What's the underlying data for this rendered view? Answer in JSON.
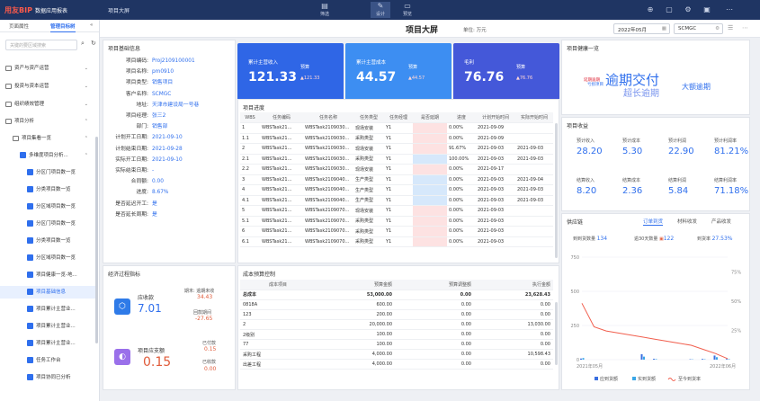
{
  "topbar": {
    "logo": "用友BIP",
    "app_name": "数据应用报表",
    "title": "项目大屏",
    "buttons": [
      "筛选",
      "设计",
      "预览"
    ]
  },
  "sidebar": {
    "tabs": [
      "页面属性",
      "管理目标树"
    ],
    "search_placeholder": "关键的要区域搜索",
    "items": [
      {
        "label": "资产与资产运营",
        "type": "folder"
      },
      {
        "label": "投资与资本运营",
        "type": "folder"
      },
      {
        "label": "组织绩效管理",
        "type": "folder"
      },
      {
        "label": "项目分析",
        "type": "folder"
      },
      {
        "label": "项目集看一览",
        "type": "folder"
      },
      {
        "label": "多维度项目分析...",
        "type": "report"
      },
      {
        "label": "分区门项目数一览",
        "type": "report"
      },
      {
        "label": "分类项目数一览",
        "type": "report"
      },
      {
        "label": "分区域项目数一览",
        "type": "report"
      },
      {
        "label": "分区门项目数一览",
        "type": "report"
      },
      {
        "label": "分类项目数一览",
        "type": "report"
      },
      {
        "label": "分区域项目数一览",
        "type": "report"
      },
      {
        "label": "项目健康一览-地...",
        "type": "report"
      },
      {
        "label": "项目基础信息",
        "type": "report"
      },
      {
        "label": "项目累计主营业...",
        "type": "report"
      },
      {
        "label": "项目累计主营业...",
        "type": "report"
      },
      {
        "label": "项目累计主营业...",
        "type": "report"
      },
      {
        "label": "任务工作台",
        "type": "report"
      },
      {
        "label": "项目协同已分析",
        "type": "report"
      }
    ]
  },
  "header": {
    "page_title": "项目大屏",
    "unit": "单位: 万元",
    "month": "2022年05月",
    "org": "SCMGC"
  },
  "basic_info": {
    "title": "项目基础信息",
    "fields": [
      {
        "label": "项目编码:",
        "value": "Proj2109100001"
      },
      {
        "label": "项目名称:",
        "value": "pm0910"
      },
      {
        "label": "项目类型:",
        "value": "销售项目"
      },
      {
        "label": "客户名称:",
        "value": "SCMGC"
      },
      {
        "label": "地址:",
        "value": "天津市建设局一号巷"
      },
      {
        "label": "项目经理:",
        "value": "张三2"
      },
      {
        "label": "部门:",
        "value": "销售部"
      },
      {
        "label": "计划开工日期:",
        "value": "2021-09-10"
      },
      {
        "label": "计划结束日期:",
        "value": "2021-09-28"
      },
      {
        "label": "实际开工日期:",
        "value": "2021-09-10"
      },
      {
        "label": "实际结束日期:",
        "value": "-"
      },
      {
        "label": "合同额:",
        "value": "0.00"
      },
      {
        "label": "进度:",
        "value": "8.67%"
      },
      {
        "label": "是否延迟开工:",
        "value": "是"
      },
      {
        "label": "是否延长周期:",
        "value": "是"
      }
    ]
  },
  "cards": [
    {
      "label": "累计主营收入",
      "value": "121.33",
      "sub_label": "预算",
      "sub_value": "▲121.33",
      "color": "#2f66e6"
    },
    {
      "label": "累计主营成本",
      "value": "44.57",
      "sub_label": "预算",
      "sub_value": "▲44.57",
      "color": "#3d8ef2"
    },
    {
      "label": "毛利",
      "value": "76.76",
      "sub_label": "预算",
      "sub_value": "▲76.76",
      "color": "#4458d9"
    }
  ],
  "progress": {
    "title": "项目进度",
    "columns": [
      "WBS",
      "任务编码",
      "任务名称",
      "任务类型",
      "任务经理",
      "是否延期",
      "进度",
      "计划开始时间",
      "实际开始时间"
    ],
    "rows": [
      [
        "1",
        "WBSTask21...",
        "WBSTask2109030...",
        "现场安装",
        "Y1",
        "",
        "0.00%",
        "2021-09-09",
        ""
      ],
      [
        "1.1",
        "WBSTask21...",
        "WBSTask2109030...",
        "采购类型",
        "Y1",
        "",
        "0.00%",
        "2021-09-09",
        ""
      ],
      [
        "2",
        "WBSTask21...",
        "WBSTask2109030...",
        "现场安装",
        "Y1",
        "",
        "91.67%",
        "2021-09-03",
        "2021-09-03"
      ],
      [
        "2.1",
        "WBSTask21...",
        "WBSTask2109030...",
        "采购类型",
        "Y1",
        "",
        "100.00%",
        "2021-09-03",
        "2021-09-03"
      ],
      [
        "2.2",
        "WBSTask21...",
        "WBSTask2109030...",
        "现场安装",
        "Y1",
        "",
        "0.00%",
        "2021-09-17",
        ""
      ],
      [
        "3",
        "WBSTask21...",
        "WBSTask2109040...",
        "生产类型",
        "Y1",
        "",
        "0.00%",
        "2021-09-03",
        "2021-09-04"
      ],
      [
        "4",
        "WBSTask21...",
        "WBSTask2109040...",
        "生产类型",
        "Y1",
        "",
        "0.00%",
        "2021-09-03",
        "2021-09-03"
      ],
      [
        "4.1",
        "WBSTask21...",
        "WBSTask2109040...",
        "生产类型",
        "Y1",
        "",
        "0.00%",
        "2021-09-03",
        "2021-09-03"
      ],
      [
        "5",
        "WBSTask21...",
        "WBSTask2109070...",
        "现场安装",
        "Y1",
        "",
        "0.00%",
        "2021-09-03",
        ""
      ],
      [
        "5.1",
        "WBSTask21...",
        "WBSTask2109070...",
        "采购类型",
        "Y1",
        "",
        "0.00%",
        "2021-09-03",
        ""
      ],
      [
        "6",
        "WBSTask21...",
        "WBSTask2109070...",
        "采购类型",
        "Y1",
        "",
        "0.00%",
        "2021-09-03",
        ""
      ],
      [
        "6.1",
        "WBSTask21...",
        "WBSTask2109070...",
        "采购类型",
        "Y1",
        "",
        "0.00%",
        "2021-09-03",
        ""
      ]
    ],
    "delay_colors": [
      "#fde2e2",
      "#fde2e2",
      "#fde2e2",
      "#d6e8fb",
      "#fde2e2",
      "#d6e8fb",
      "#d6e8fb",
      "#d6e8fb",
      "#fde2e2",
      "#fde2e2",
      "#fde2e2",
      "#fde2e2"
    ]
  },
  "econ": {
    "title": "经济过程指标",
    "revenue_label": "应收款",
    "revenue_value": "7.01",
    "period_label": "期末: 逾期未收",
    "period_value": "34.43",
    "return_label": "回款期间",
    "return_value": "-27.65",
    "pay_label": "项目应支额",
    "pay_value": "0.15",
    "paid_label": "已付款",
    "paid_value": "0.15",
    "unpaid_label": "已收款",
    "unpaid_value": "0.00"
  },
  "cost": {
    "title": "成本预算控制",
    "columns": [
      "成本项目",
      "预算金额",
      "预算调整额",
      "执行金额"
    ],
    "total": [
      "总成本",
      "53,000.00",
      "0.00",
      "23,628.43"
    ],
    "rows": [
      [
        "0818A",
        "600.00",
        "0.00",
        "0.00"
      ],
      [
        "123",
        "200.00",
        "0.00",
        "0.00"
      ],
      [
        "2",
        "20,000.00",
        "0.00",
        "13,030.00"
      ],
      [
        "2级别",
        "100.00",
        "0.00",
        "0.00"
      ],
      [
        "77",
        "100.00",
        "0.00",
        "0.00"
      ],
      [
        "采购工程",
        "4,000.00",
        "0.00",
        "10,598.43"
      ],
      [
        "出差工程",
        "4,000.00",
        "0.00",
        "0.00"
      ]
    ]
  },
  "health": {
    "title": "项目健康一览",
    "words": [
      "逾期交付",
      "超长逾期",
      "大额逾期",
      "延期逾期",
      "亏损项目"
    ]
  },
  "revenue": {
    "title": "项目收益",
    "kpis": [
      {
        "label": "预计收入",
        "value": "28.20"
      },
      {
        "label": "预计成本",
        "value": "5.30"
      },
      {
        "label": "预计利润",
        "value": "22.90"
      },
      {
        "label": "预计利润率",
        "value": "81.21%"
      },
      {
        "label": "结算收入",
        "value": "8.20"
      },
      {
        "label": "结算成本",
        "value": "2.36"
      },
      {
        "label": "结算利润",
        "value": "5.84"
      },
      {
        "label": "结算利润率",
        "value": "71.18%"
      }
    ]
  },
  "supply": {
    "title": "供应链",
    "tabs": [
      "订单到货",
      "材料收发",
      "产品收发"
    ],
    "stats": [
      {
        "label": "到到货数量",
        "value": "134"
      },
      {
        "label": "逾30天数量",
        "value": "122"
      },
      {
        "label": "到货率",
        "value": "27.53%"
      }
    ]
  },
  "chart_data": {
    "type": "bar",
    "title": "",
    "xlabel": "",
    "ylabel": "",
    "ylim": [
      0,
      750
    ],
    "y2lim": [
      0,
      100
    ],
    "y_ticks": [
      "750",
      "500",
      "250",
      "0"
    ],
    "y2_ticks": [
      "75%",
      "50%",
      "25%"
    ],
    "x_start": "2021年05月",
    "x_end": "2022年06月",
    "legend": [
      "应到货额",
      "实到货额",
      "至今到货率"
    ],
    "colors": [
      "#3a6fe0",
      "#3aa7e8",
      "#f15f4e"
    ],
    "series": [
      {
        "name": "应到货额",
        "values": [
          8,
          0,
          0,
          0,
          0,
          40,
          6,
          0,
          0,
          3,
          5,
          30,
          5
        ]
      },
      {
        "name": "实到货额",
        "values": [
          12,
          0,
          0,
          0,
          0,
          22,
          4,
          0,
          0,
          2,
          3,
          18,
          4
        ]
      },
      {
        "name": "至今到货率",
        "values": [
          55,
          32,
          28,
          26,
          24,
          22,
          20,
          18,
          16,
          14,
          10,
          6,
          1
        ]
      }
    ]
  }
}
